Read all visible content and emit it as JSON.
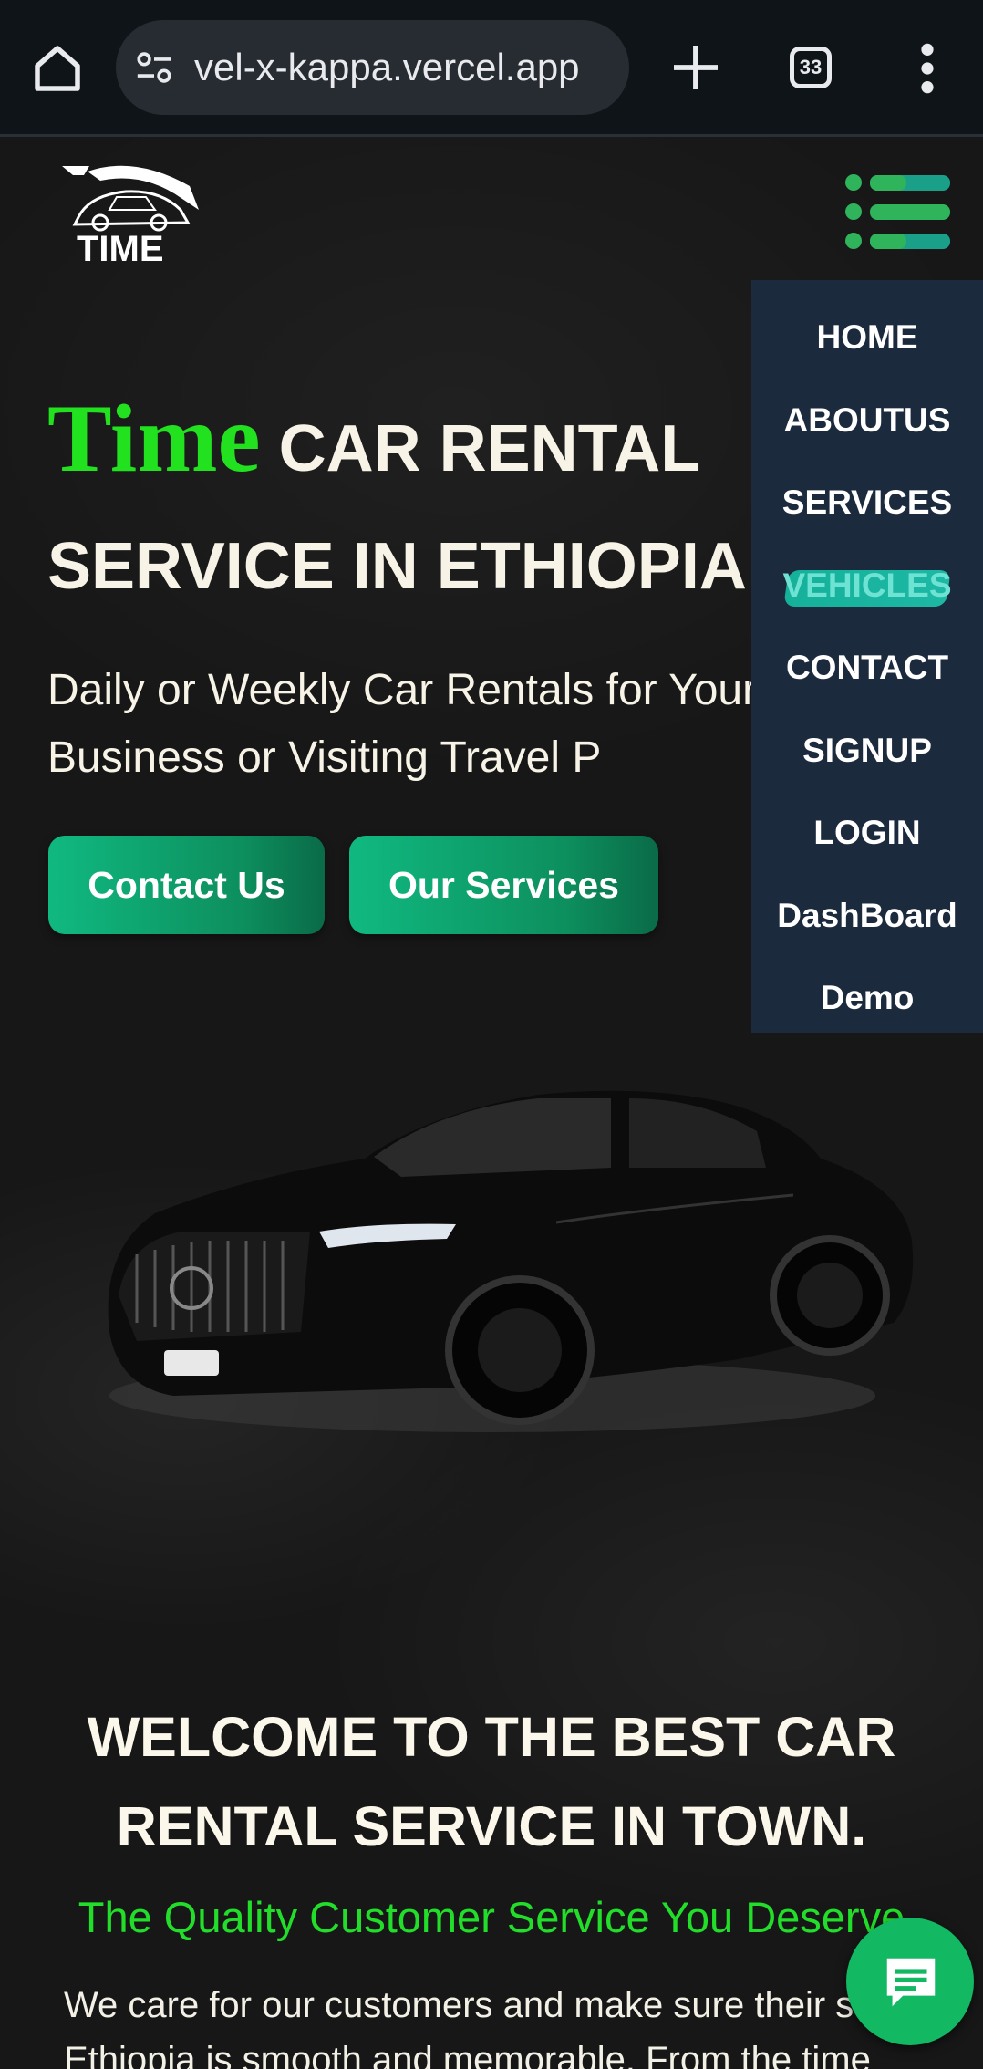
{
  "browser": {
    "url": "vel-x-kappa.vercel.app",
    "tab_count": "33",
    "icons": [
      "home-icon",
      "site-settings-icon",
      "new-tab-icon",
      "tab-switcher-icon",
      "more-options-icon"
    ]
  },
  "header": {
    "logo_text": "TIME",
    "menu_icon": "hamburger-menu-icon"
  },
  "hero": {
    "brand_word": "Time",
    "title_line1_rest": "CAR RENTAL",
    "title_line2": "SERVICE IN ETHIOPIA",
    "subtitle": "Daily or Weekly Car Rentals for Your Business or Visiting Travel P",
    "buttons": {
      "contact": "Contact Us",
      "services": "Our Services"
    }
  },
  "nav": {
    "items": [
      "HOME",
      "ABOUTUS",
      "SERVICES",
      "VEHICLES",
      "CONTACT",
      "SIGNUP",
      "LOGIN",
      "DashBoard",
      "Demo"
    ]
  },
  "welcome": {
    "heading": "WELCOME TO THE BEST CAR RENTAL SERVICE IN TOWN.",
    "tagline": "The Quality Customer Service You Deserve",
    "body": "We care for our customers and make sure their s Ethiopia is smooth and memorable. From the time we"
  },
  "colors": {
    "brand_green": "#22e11f",
    "button_green": "#10b981",
    "nav_bg": "#1c2a3e",
    "chat_green": "#13b862"
  },
  "chat_icon": "chat-message-icon"
}
